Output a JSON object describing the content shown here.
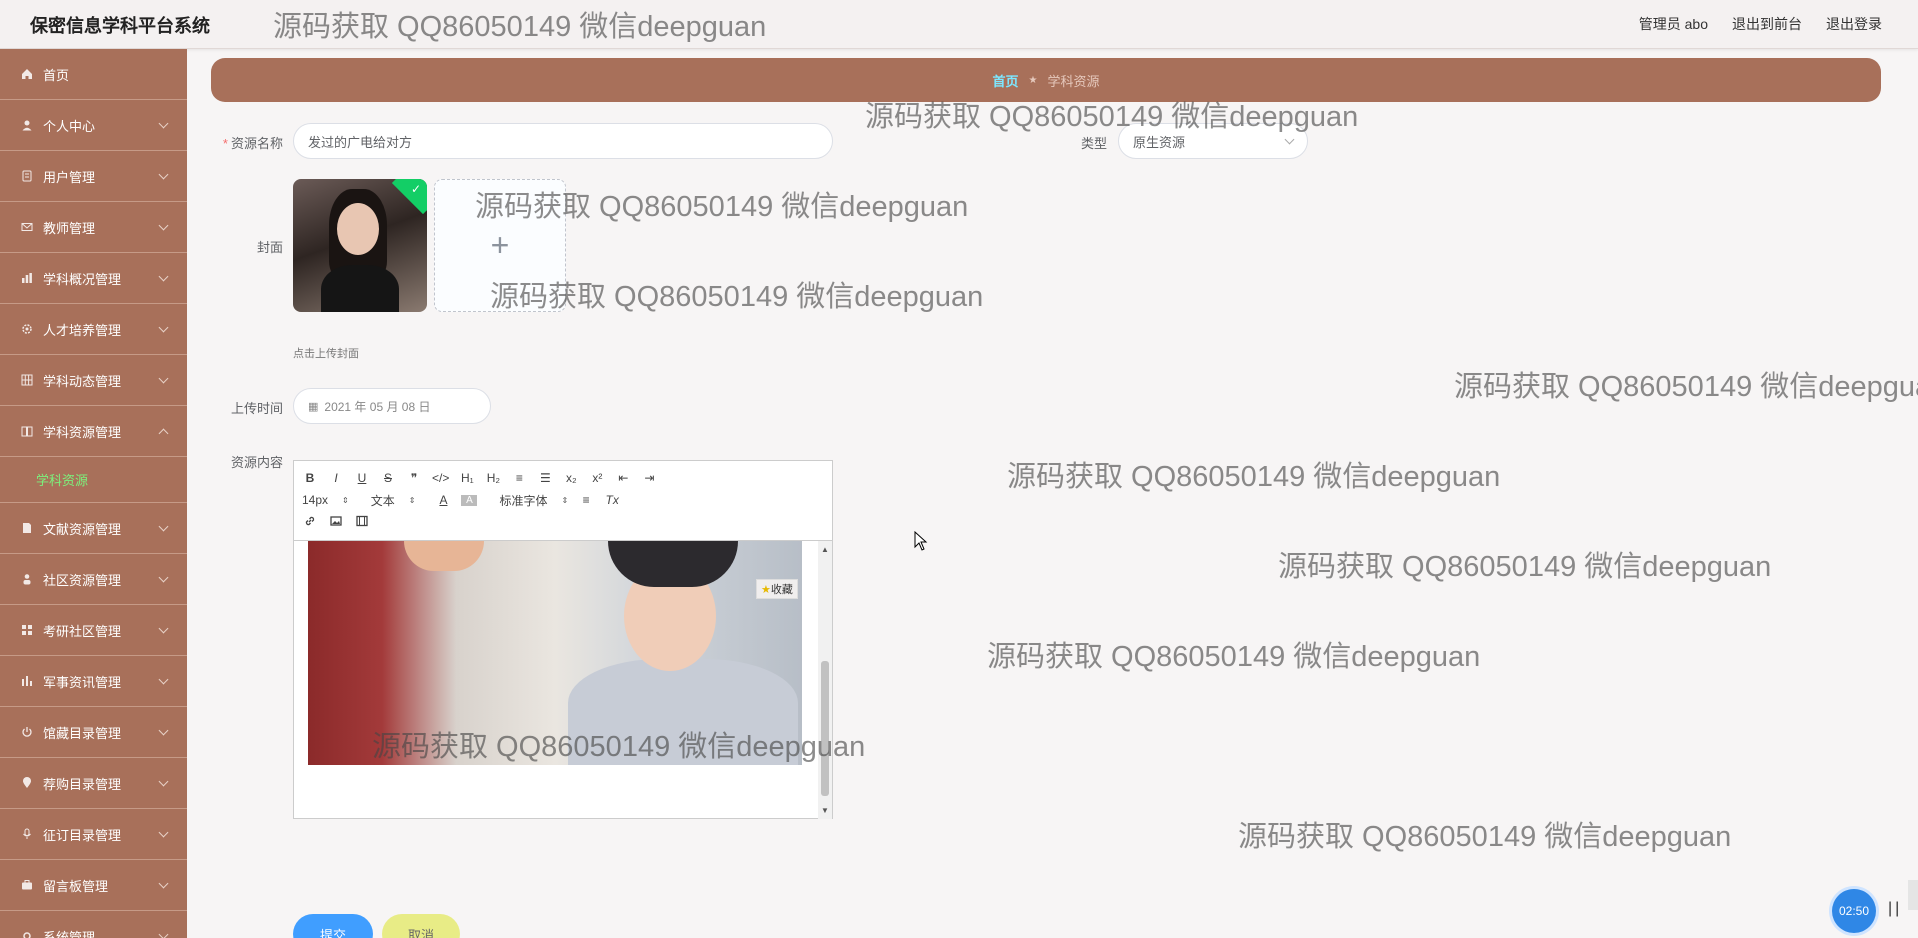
{
  "app": {
    "title": "保密信息学科平台系统"
  },
  "topbar": {
    "user": "管理员 abo",
    "to_front": "退出到前台",
    "logout": "退出登录"
  },
  "sidebar": {
    "items": [
      {
        "label": "首页",
        "icon": "home-icon"
      },
      {
        "label": "个人中心",
        "icon": "user-icon"
      },
      {
        "label": "用户管理",
        "icon": "users-icon"
      },
      {
        "label": "教师管理",
        "icon": "mail-icon"
      },
      {
        "label": "学科概况管理",
        "icon": "chart-icon"
      },
      {
        "label": "人才培养管理",
        "icon": "gear-icon"
      },
      {
        "label": "学科动态管理",
        "icon": "grid-icon"
      },
      {
        "label": "学科资源管理",
        "icon": "book-icon"
      },
      {
        "label": "文献资源管理",
        "icon": "document-icon"
      },
      {
        "label": "社区资源管理",
        "icon": "person-icon"
      },
      {
        "label": "考研社区管理",
        "icon": "apps-icon"
      },
      {
        "label": "军事资讯管理",
        "icon": "bar-chart-icon"
      },
      {
        "label": "馆藏目录管理",
        "icon": "power-icon"
      },
      {
        "label": "荐购目录管理",
        "icon": "location-icon"
      },
      {
        "label": "征订目录管理",
        "icon": "microphone-icon"
      },
      {
        "label": "留言板管理",
        "icon": "briefcase-icon"
      },
      {
        "label": "系统管理",
        "icon": "settings-icon"
      }
    ],
    "active_sub": "学科资源"
  },
  "breadcrumb": {
    "home": "首页",
    "current": "学科资源"
  },
  "form": {
    "name_label": "资源名称",
    "name_value": "发过的广电给对方",
    "type_label": "类型",
    "type_value": "原生资源",
    "cover_label": "封面",
    "cover_hint": "点击上传封面",
    "time_label": "上传时间",
    "time_value": "2021 年 05 月 08 日",
    "content_label": "资源内容",
    "submit": "提交",
    "cancel": "取消"
  },
  "editor": {
    "row1": [
      "B",
      "I",
      "U",
      "S",
      "❞",
      "</>",
      "H₁",
      "H₂",
      "≡",
      "☰",
      "x₂",
      "x²",
      "⇤",
      "⇥"
    ],
    "font_size": "14px",
    "format": "文本",
    "font_family": "标准字体",
    "favorite": "收藏"
  },
  "media": {
    "timer": "02:50"
  },
  "watermark": "源码获取 QQ86050149 微信deepguan",
  "colors": {
    "sidebar": "#a8705a",
    "accent": "#409eff",
    "active_sub": "#7cf27c"
  }
}
